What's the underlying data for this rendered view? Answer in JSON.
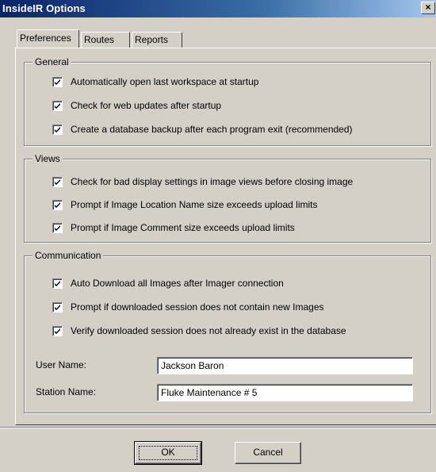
{
  "window": {
    "title": "InsideIR Options",
    "close_glyph": "×"
  },
  "tabs": [
    {
      "label": "Preferences",
      "active": true
    },
    {
      "label": "Routes",
      "active": false
    },
    {
      "label": "Reports",
      "active": false
    }
  ],
  "groups": {
    "general": {
      "title": "General",
      "items": [
        {
          "label": "Automatically open last workspace at startup",
          "checked": true
        },
        {
          "label": "Check for web updates after startup",
          "checked": true
        },
        {
          "label": "Create a database backup after each program exit (recommended)",
          "checked": true
        }
      ]
    },
    "views": {
      "title": "Views",
      "items": [
        {
          "label": "Check for bad display settings in image views before closing image",
          "checked": true
        },
        {
          "label": "Prompt if Image Location Name size exceeds upload limits",
          "checked": true
        },
        {
          "label": "Prompt if Image Comment size exceeds upload limits",
          "checked": true
        }
      ]
    },
    "communication": {
      "title": "Communication",
      "items": [
        {
          "label": "Auto Download all Images after Imager connection",
          "checked": true
        },
        {
          "label": "Prompt if downloaded session does not contain new Images",
          "checked": true
        },
        {
          "label": "Verify downloaded session does not already exist in the database",
          "checked": true
        }
      ],
      "user_name_label": "User Name:",
      "user_name_value": "Jackson Baron",
      "station_name_label": "Station Name:",
      "station_name_value": "Fluke Maintenance # 5"
    }
  },
  "buttons": {
    "ok": "OK",
    "cancel": "Cancel"
  },
  "colors": {
    "face": "#d4d0c8",
    "title_start": "#0a246a",
    "title_end": "#a6caf0"
  }
}
